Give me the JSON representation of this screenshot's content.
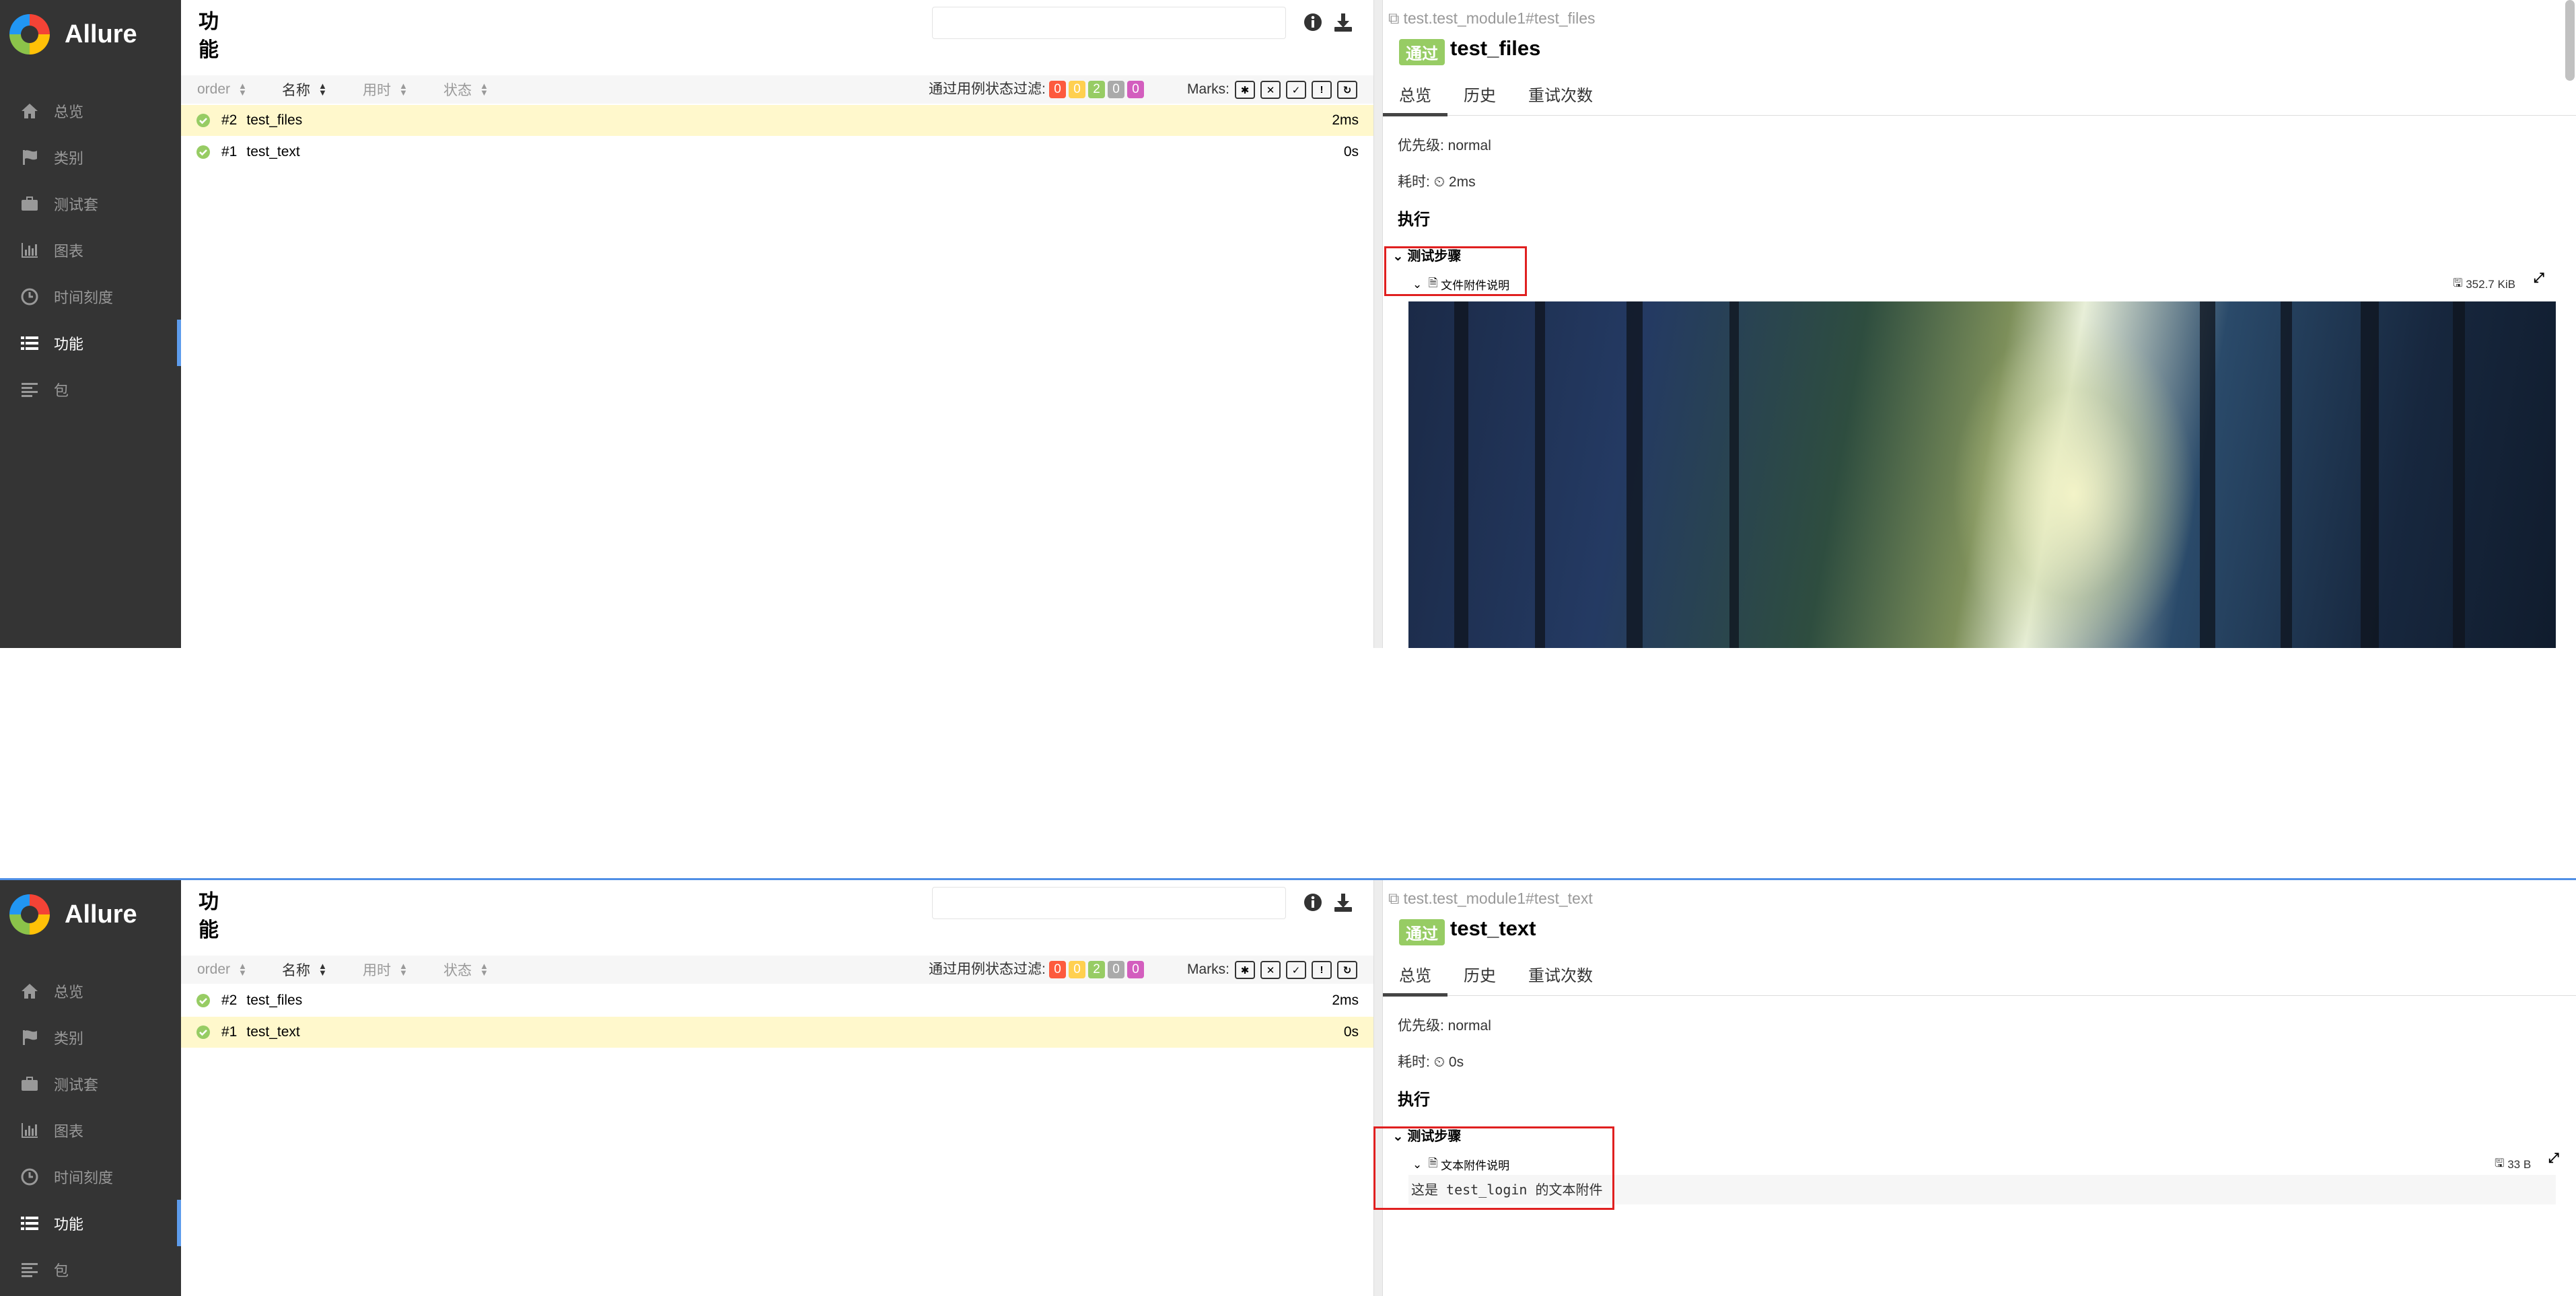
{
  "app": {
    "brand": "Allure",
    "nav": [
      {
        "label": "总览",
        "icon": "home-icon"
      },
      {
        "label": "类别",
        "icon": "flag-icon"
      },
      {
        "label": "测试套",
        "icon": "briefcase-icon"
      },
      {
        "label": "图表",
        "icon": "bar-chart-icon"
      },
      {
        "label": "时间刻度",
        "icon": "clock-icon"
      },
      {
        "label": "功能",
        "icon": "list-icon"
      },
      {
        "label": "包",
        "icon": "align-left-icon"
      }
    ],
    "active_nav": "功能"
  },
  "list": {
    "title": "功能",
    "search_value": "",
    "columns": {
      "order": "order",
      "name": "名称",
      "duration": "用时",
      "status": "状态"
    },
    "filter_label": "通过用例状态过滤:",
    "status_filters": [
      {
        "count": "0",
        "color": "#fd5a3e"
      },
      {
        "count": "0",
        "color": "#ffd050"
      },
      {
        "count": "2",
        "color": "#97cc64"
      },
      {
        "count": "0",
        "color": "#aaaaaa"
      },
      {
        "count": "0",
        "color": "#d35ebe"
      }
    ],
    "marks_label": "Marks:",
    "rows": [
      {
        "num": "#2",
        "name": "test_files",
        "duration": "2ms"
      },
      {
        "num": "#1",
        "name": "test_text",
        "duration": "0s"
      }
    ]
  },
  "panes": [
    {
      "selected_row": 0,
      "detail": {
        "path": "test.test_module1#test_files",
        "status": "通过",
        "title": "test_files",
        "tabs": [
          "总览",
          "历史",
          "重试次数"
        ],
        "severity": "优先级: normal",
        "duration_label": "耗时:",
        "duration": "2ms",
        "execution": "执行",
        "steps_header": "测试步骤",
        "attachment_name": "文件附件说明",
        "attachment_size": "352.7 KiB"
      }
    },
    {
      "selected_row": 1,
      "detail": {
        "path": "test.test_module1#test_text",
        "status": "通过",
        "title": "test_text",
        "tabs": [
          "总览",
          "历史",
          "重试次数"
        ],
        "severity": "优先级: normal",
        "duration_label": "耗时:",
        "duration": "0s",
        "execution": "执行",
        "steps_header": "测试步骤",
        "attachment_name": "文本附件说明",
        "attachment_size": "33 B",
        "attachment_text": "这是 test_login 的文本附件"
      }
    }
  ]
}
